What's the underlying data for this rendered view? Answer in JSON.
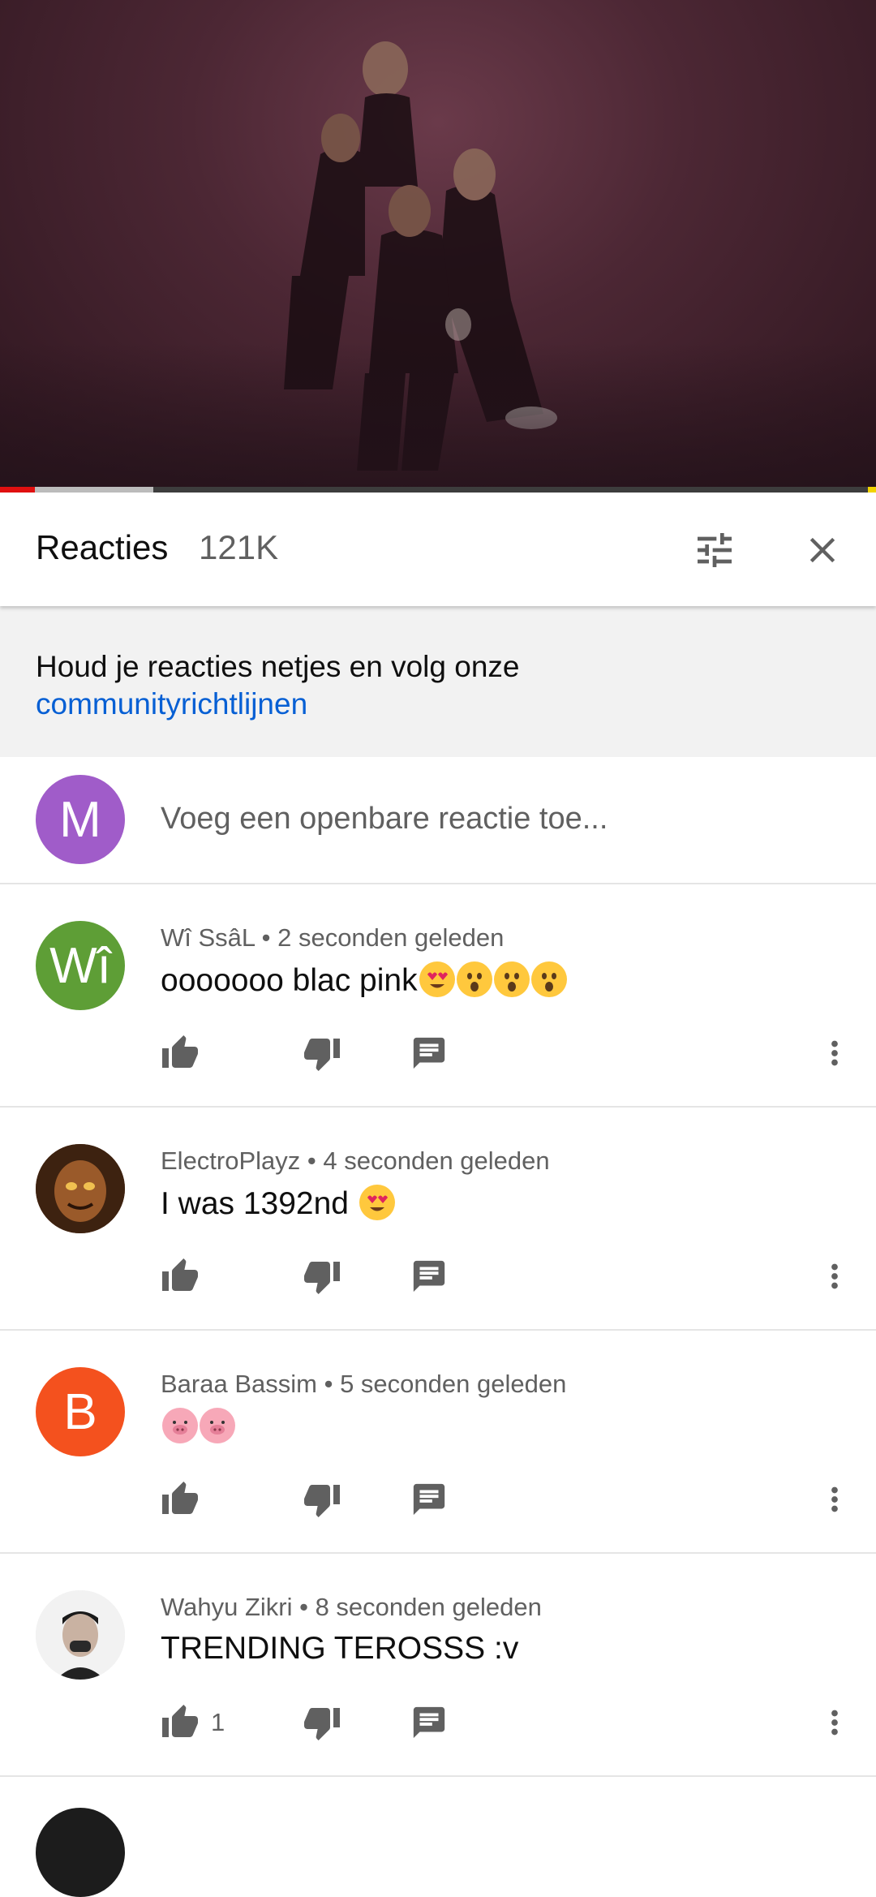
{
  "video": {
    "progress_played_pct": 4,
    "progress_buffered_pct": 17.5
  },
  "header": {
    "title": "Reacties",
    "count": "121K",
    "filter_icon": "tune-icon",
    "close_icon": "close-icon"
  },
  "notice": {
    "text": "Houd je reacties netjes en volg onze",
    "link": "communityrichtlijnen"
  },
  "add_comment": {
    "avatar_letter": "M",
    "avatar_color": "#a05cc9",
    "placeholder": "Voeg een openbare reactie toe..."
  },
  "comments": [
    {
      "author": "Wî SsâL",
      "time": "2 seconden geleden",
      "text": "ooooooo blac pink",
      "emoji": [
        "heart-eyes",
        "astonished",
        "astonished",
        "astonished"
      ],
      "avatar_letter": "Wî",
      "avatar_color": "#5e9e36",
      "likes": ""
    },
    {
      "author": "ElectroPlayz",
      "time": "4 seconden geleden",
      "text": "I was 1392nd ",
      "emoji": [
        "heart-eyes"
      ],
      "avatar_letter": "",
      "avatar_color": "#6b3b1e",
      "likes": ""
    },
    {
      "author": "Baraa Bassim",
      "time": "5 seconden geleden",
      "text": "",
      "emoji": [
        "pig",
        "pig"
      ],
      "avatar_letter": "B",
      "avatar_color": "#f4511e",
      "likes": ""
    },
    {
      "author": "Wahyu Zikri",
      "time": "8 seconden geleden",
      "text": "TRENDING TEROSSS :v",
      "emoji": [],
      "avatar_letter": "",
      "avatar_color": "#e8e8e8",
      "likes": "1"
    }
  ],
  "colors": {
    "accent_red": "#e01010",
    "link_blue": "#065fd4",
    "icon_gray": "#606060"
  }
}
